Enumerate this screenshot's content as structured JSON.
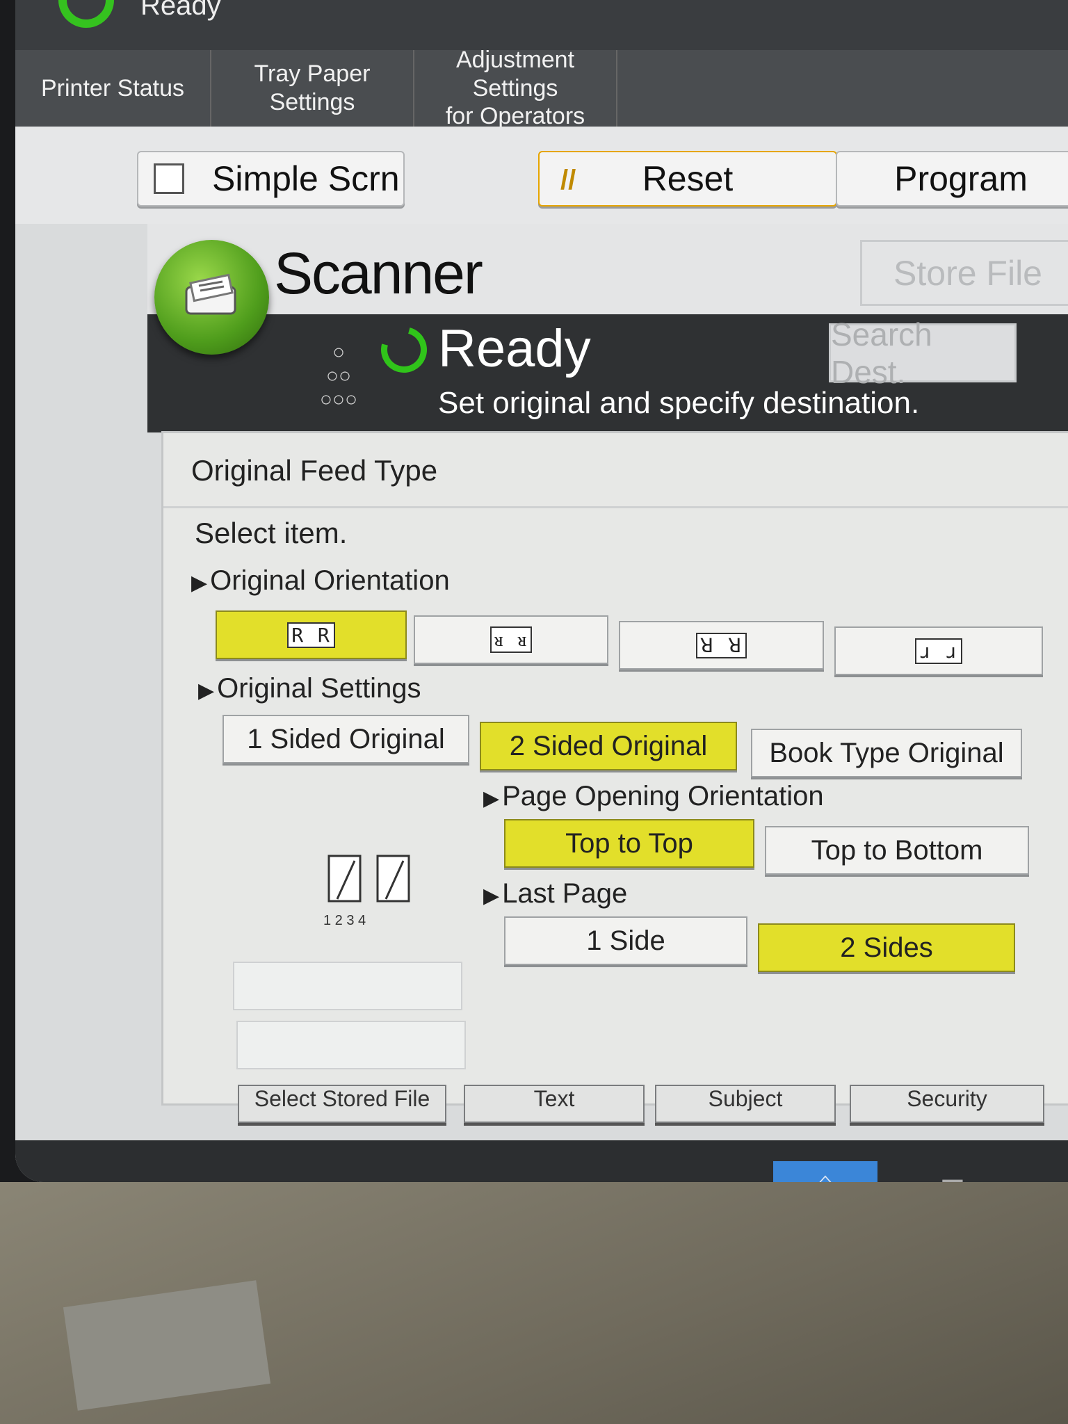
{
  "topbar": {
    "title": "Ready"
  },
  "tabs": [
    {
      "label": "Printer Status"
    },
    {
      "label": "Tray Paper Settings"
    },
    {
      "label_line1": "Adjustment Settings",
      "label_line2": "for Operators"
    }
  ],
  "function_row": {
    "simple_label": "Simple Scrn",
    "reset_label": "Reset",
    "program_label": "Program"
  },
  "scanner": {
    "title": "Scanner",
    "store_file": "Store File",
    "status": "Ready",
    "message": "Set original and specify destination.",
    "search_dest": "Search Dest."
  },
  "dialog": {
    "title": "Original Feed Type",
    "subtitle": "Select item.",
    "orientation_label": "Original Orientation",
    "orientation_options": [
      {
        "glyph": "R R",
        "selected": true
      },
      {
        "glyph": "ᴚ ᴚ",
        "selected": false
      },
      {
        "glyph": "ꓤ ꓤ",
        "selected": false
      },
      {
        "glyph": "ɹ ɹ",
        "selected": false
      }
    ],
    "settings_label": "Original Settings",
    "settings_options": [
      {
        "label": "1 Sided Original",
        "selected": false
      },
      {
        "label": "2 Sided Original",
        "selected": true
      },
      {
        "label": "Book Type Original",
        "selected": false
      }
    ],
    "page_opening_label": "Page Opening Orientation",
    "page_opening_options": [
      {
        "label": "Top to Top",
        "selected": true
      },
      {
        "label": "Top to Bottom",
        "selected": false
      }
    ],
    "last_page_label": "Last Page",
    "last_page_options": [
      {
        "label": "1 Side",
        "selected": false
      },
      {
        "label": "2 Sides",
        "selected": true
      }
    ],
    "page_icon_text": "1 2 3 4"
  },
  "bottom_tabs": [
    {
      "label": "Select Stored File"
    },
    {
      "label": "Text"
    },
    {
      "label": "Subject"
    },
    {
      "label": "Security"
    }
  ],
  "colors": {
    "selected": "#e2df2a",
    "ready_green": "#30c41a",
    "home_blue": "#3b86d8"
  },
  "icons": [
    "scanner-icon",
    "check-ring-icon",
    "home-icon",
    "menu-icon",
    "reset-icon"
  ]
}
